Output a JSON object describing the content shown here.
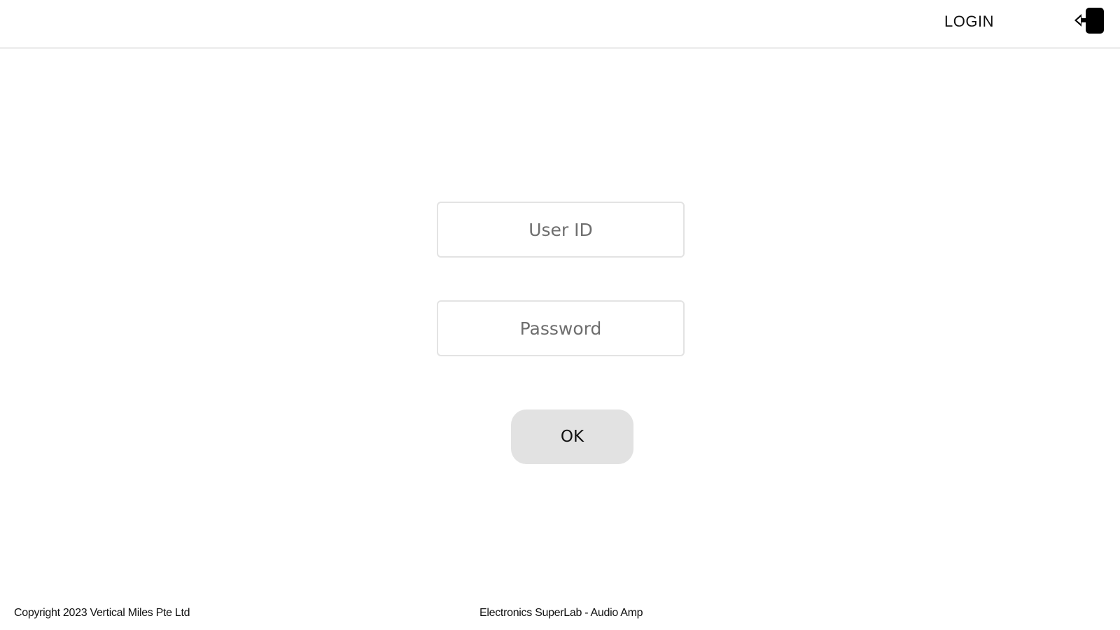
{
  "header": {
    "title": "LOGIN",
    "logout_icon": "sign-out-icon"
  },
  "form": {
    "user_id": {
      "placeholder": "User ID",
      "value": ""
    },
    "password": {
      "placeholder": "Password",
      "value": ""
    },
    "ok_label": "OK"
  },
  "footer": {
    "copyright": "Copyright 2023 Vertical Miles Pte Ltd",
    "app_name": "Electronics SuperLab - Audio Amp"
  },
  "colors": {
    "button_bg": "#e2e2e2",
    "field_border": "#e3e3e3",
    "header_border": "#efefef"
  }
}
